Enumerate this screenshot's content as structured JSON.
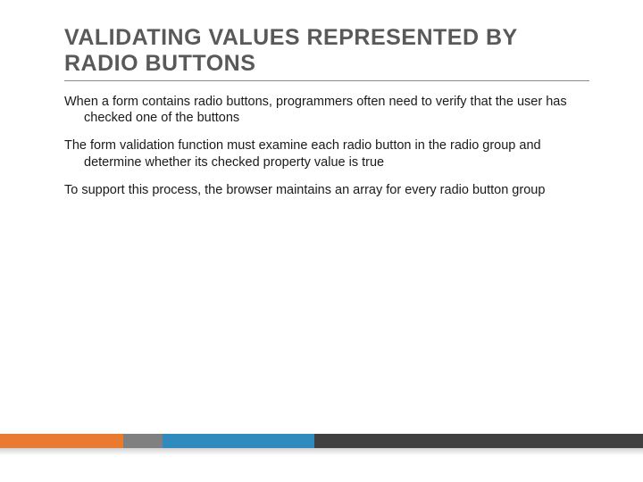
{
  "title": "VALIDATING VALUES REPRESENTED BY RADIO BUTTONS",
  "paragraphs": [
    "When a form contains radio buttons, programmers often need to verify that the user has checked one of the buttons",
    "The form validation function must examine each radio button in the radio group and determine whether its checked property value is true",
    "To support this process, the browser maintains an array for every radio button group"
  ],
  "colors": {
    "bar1": "#e87b2f",
    "bar2": "#808080",
    "bar3": "#2f8bbd",
    "bar4": "#404040"
  }
}
